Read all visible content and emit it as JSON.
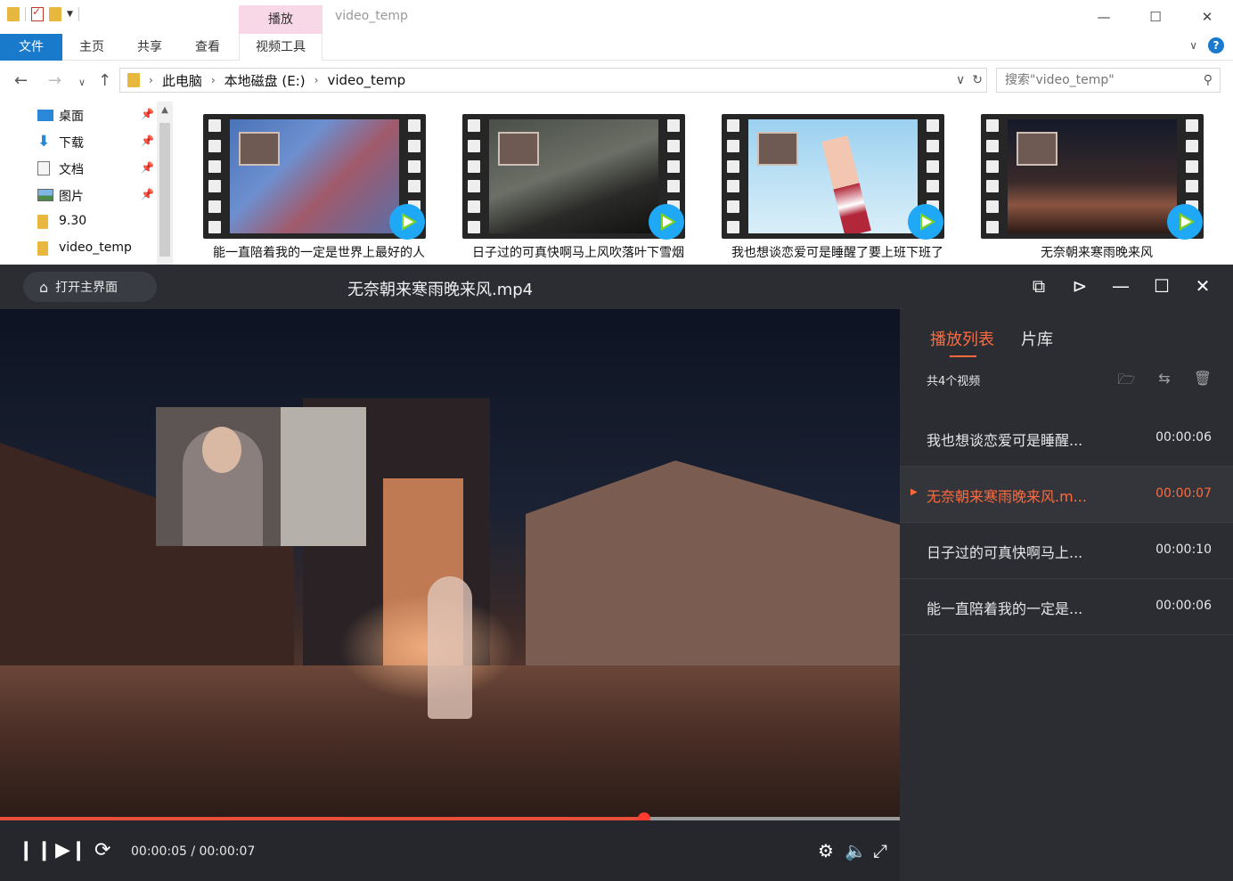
{
  "explorer": {
    "context_tab": "播放",
    "window_title": "video_temp",
    "window_controls": [
      "—",
      "☐",
      "✕"
    ],
    "ribbon_tabs": [
      "文件",
      "主页",
      "共享",
      "查看",
      "视频工具"
    ],
    "path": [
      "此电脑",
      "本地磁盘 (E:)",
      "video_temp"
    ],
    "search_placeholder": "搜索\"video_temp\"",
    "nav_items": [
      {
        "label": "桌面",
        "icon": "desktop-icon",
        "pinned": true
      },
      {
        "label": "下载",
        "icon": "download-icon",
        "pinned": true
      },
      {
        "label": "文档",
        "icon": "document-icon",
        "pinned": true
      },
      {
        "label": "图片",
        "icon": "picture-icon",
        "pinned": true
      },
      {
        "label": "9.30",
        "icon": "folder-icon",
        "pinned": false
      },
      {
        "label": "video_temp",
        "icon": "folder-icon",
        "pinned": false
      }
    ],
    "files": [
      {
        "name": "能一直陪着我的一定是世界上最好的人"
      },
      {
        "name": "日子过的可真快啊马上风吹落叶下雪烟"
      },
      {
        "name": "我也想谈恋爱可是睡醒了要上班下班了"
      },
      {
        "name": "无奈朝来寒雨晚来风"
      }
    ]
  },
  "player": {
    "home_button": "打开主界面",
    "title": "无奈朝来寒雨晚来风.mp4",
    "time_display": "00:00:05 / 00:00:07",
    "progress_fraction": 0.716,
    "accent_color": "#ff6a3d",
    "side": {
      "tabs": [
        "播放列表",
        "片库"
      ],
      "count_label": "共4个视频",
      "items": [
        {
          "name": "我也想谈恋爱可是睡醒...",
          "duration": "00:00:06",
          "current": false
        },
        {
          "name": "无奈朝来寒雨晚来风.m...",
          "duration": "00:00:07",
          "current": true
        },
        {
          "name": "日子过的可真快啊马上...",
          "duration": "00:00:10",
          "current": false
        },
        {
          "name": "能一直陪着我的一定是...",
          "duration": "00:00:06",
          "current": false
        }
      ]
    }
  }
}
